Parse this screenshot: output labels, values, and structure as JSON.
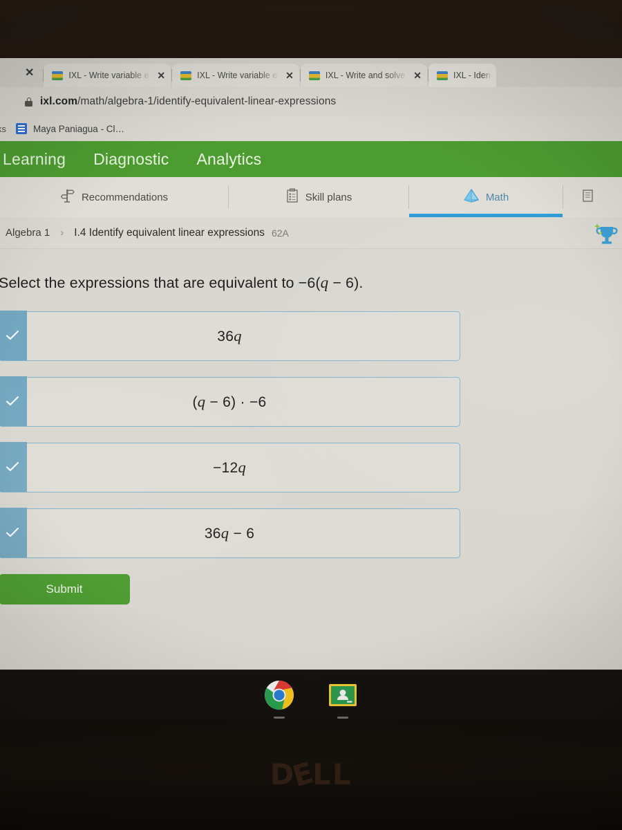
{
  "browser": {
    "tabs": [
      {
        "title": "IXL - Write variable e",
        "favicon": "ixl-favicon",
        "close_label": "✕"
      },
      {
        "title": "IXL - Write variable e",
        "favicon": "ixl-favicon",
        "close_label": "✕"
      },
      {
        "title": "IXL - Write and solve",
        "favicon": "ixl-favicon",
        "close_label": "✕"
      },
      {
        "title": "IXL - Iden",
        "favicon": "ixl-favicon",
        "close_label": "✕"
      }
    ],
    "leading_close_label": "✕",
    "omnibox": {
      "lock_icon": "lock-icon",
      "url_domain": "ixl.com",
      "url_path": "/math/algebra-1/identify-equivalent-linear-expressions"
    },
    "bookmarks": {
      "cut_label": "ks",
      "items": [
        {
          "label": "Maya Paniagua - Cl…",
          "favicon": "classroom-favicon"
        }
      ]
    }
  },
  "ixl": {
    "green_nav": [
      {
        "label": "Learning",
        "active": true
      },
      {
        "label": "Diagnostic",
        "active": false
      },
      {
        "label": "Analytics",
        "active": false
      }
    ],
    "subnav": [
      {
        "label": "Recommendations",
        "icon": "signpost-icon",
        "active": false
      },
      {
        "label": "Skill plans",
        "icon": "checklist-icon",
        "active": false
      },
      {
        "label": "Math",
        "icon": "pyramid-icon",
        "active": true
      }
    ],
    "breadcrumb": {
      "course": "Algebra 1",
      "separator": "›",
      "skill": "I.4 Identify equivalent linear expressions",
      "code": "62A",
      "award_icon": "trophy-icon"
    }
  },
  "question": {
    "prompt_before": "Select the expressions that are equivalent to −6(",
    "prompt_var": "q",
    "prompt_after": " − 6).",
    "choices": [
      {
        "text": "36",
        "var": "q",
        "text_after": "",
        "checked": true
      },
      {
        "text": "(",
        "var": "q",
        "text_after": " − 6) · −6",
        "checked": true
      },
      {
        "text": "−12",
        "var": "q",
        "text_after": "",
        "checked": true
      },
      {
        "text": "36",
        "var": "q",
        "text_after": " − 6",
        "checked": true
      }
    ],
    "submit_label": "Submit"
  },
  "shelf": {
    "apps": [
      {
        "name": "chrome-icon"
      },
      {
        "name": "google-classroom-icon"
      }
    ]
  },
  "device": {
    "brand_d": "D",
    "brand_e": "E",
    "brand_ll": "LL"
  },
  "colors": {
    "ixl_green": "#4d9c31",
    "choice_teal": "#73a7c0",
    "choice_border": "#7fb4cb",
    "math_blue": "#2e9bd6",
    "page_bg": "#d9d7d0"
  }
}
